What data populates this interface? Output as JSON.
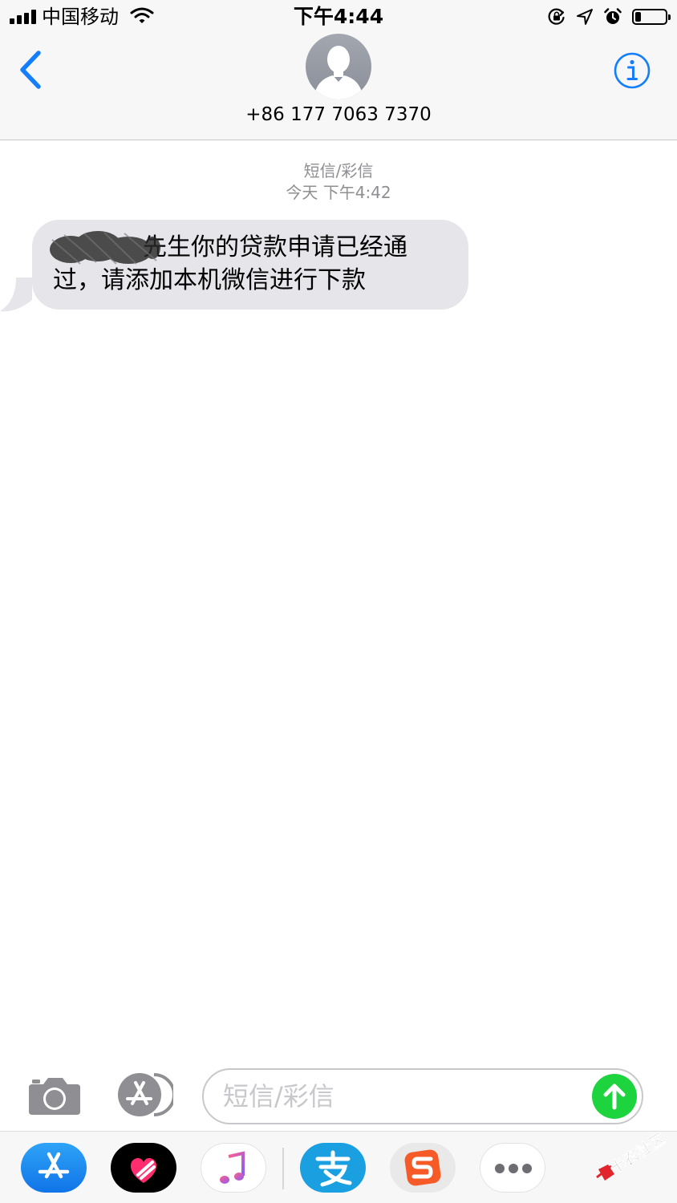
{
  "status_bar": {
    "carrier": "中国移动",
    "time": "下午4:44",
    "battery_level": 0.2
  },
  "header": {
    "contact": "+86 177 7063 7370"
  },
  "conversation": {
    "service_label": "短信/彩信",
    "timestamp": "今天 下午4:42",
    "messages": [
      {
        "visible_text_line1": "先生你的贷款申请已经通",
        "text_line2": "过，请添加本机微信进行下款"
      }
    ]
  },
  "input_bar": {
    "placeholder": "短信/彩信",
    "value": ""
  },
  "app_drawer": {
    "apps": [
      "app-store-icon",
      "digital-touch-icon",
      "music-icon",
      "alipay-icon",
      "sogou-icon",
      "more-icon"
    ]
  },
  "watermark": {
    "text": "卡农社区"
  },
  "colors": {
    "ios_blue": "#157efb",
    "bubble_gray": "#e5e5ea",
    "send_green": "#1dd43e",
    "alipay_blue": "#1a9fe0",
    "sogou_orange": "#f65a26"
  }
}
